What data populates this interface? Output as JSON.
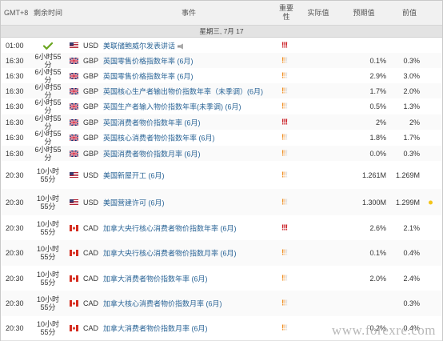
{
  "header": {
    "tz": "GMT+8",
    "remaining": "剩余时间",
    "event": "事件",
    "importance": "重要性",
    "actual": "实际值",
    "forecast": "预期值",
    "previous": "前值"
  },
  "day_label": "星期三, 7月 17",
  "watermark": "www.forexre.com",
  "rows": [
    {
      "time": "01:00",
      "left": "",
      "done": true,
      "flag": "us",
      "cur": "USD",
      "event": "美联储鲍威尔发表讲话",
      "speech": true,
      "imp": 3,
      "actual": "",
      "forecast": "",
      "previous": "",
      "dot": false
    },
    {
      "time": "16:30",
      "left": "6小时55分",
      "done": false,
      "flag": "gb",
      "cur": "GBP",
      "event": "英国零售价格指数年率 (6月)",
      "speech": false,
      "imp": 2,
      "actual": "",
      "forecast": "0.1%",
      "previous": "0.3%",
      "dot": false
    },
    {
      "time": "16:30",
      "left": "6小时55分",
      "done": false,
      "flag": "gb",
      "cur": "GBP",
      "event": "英国零售价格指数年率 (6月)",
      "speech": false,
      "imp": 2,
      "actual": "",
      "forecast": "2.9%",
      "previous": "3.0%",
      "dot": false
    },
    {
      "time": "16:30",
      "left": "6小时55分",
      "done": false,
      "flag": "gb",
      "cur": "GBP",
      "event": "英国核心生产者输出物价指数年率（未季调）(6月)",
      "speech": false,
      "imp": 2,
      "actual": "",
      "forecast": "1.7%",
      "previous": "2.0%",
      "dot": false
    },
    {
      "time": "16:30",
      "left": "6小时55分",
      "done": false,
      "flag": "gb",
      "cur": "GBP",
      "event": "英国生产者输入物价指数年率(未季调) (6月)",
      "speech": false,
      "imp": 2,
      "actual": "",
      "forecast": "0.5%",
      "previous": "1.3%",
      "dot": false
    },
    {
      "time": "16:30",
      "left": "6小时55分",
      "done": false,
      "flag": "gb",
      "cur": "GBP",
      "event": "英国消费者物价指数年率 (6月)",
      "speech": false,
      "imp": 3,
      "actual": "",
      "forecast": "2%",
      "previous": "2%",
      "dot": false
    },
    {
      "time": "16:30",
      "left": "6小时55分",
      "done": false,
      "flag": "gb",
      "cur": "GBP",
      "event": "英国核心消费者物价指数年率 (6月)",
      "speech": false,
      "imp": 2,
      "actual": "",
      "forecast": "1.8%",
      "previous": "1.7%",
      "dot": false
    },
    {
      "time": "16:30",
      "left": "6小时55分",
      "done": false,
      "flag": "gb",
      "cur": "GBP",
      "event": "英国消费者物价指数月率 (6月)",
      "speech": false,
      "imp": 2,
      "actual": "",
      "forecast": "0.0%",
      "previous": "0.3%",
      "dot": false
    },
    {
      "time": "20:30",
      "left": "10小时55分",
      "done": false,
      "flag": "us",
      "cur": "USD",
      "event": "美国新屋开工 (6月)",
      "speech": false,
      "imp": 2,
      "actual": "",
      "forecast": "1.261M",
      "previous": "1.269M",
      "dot": false
    },
    {
      "time": "20:30",
      "left": "10小时55分",
      "done": false,
      "flag": "us",
      "cur": "USD",
      "event": "美国营建许可 (6月)",
      "speech": false,
      "imp": 2,
      "actual": "",
      "forecast": "1.300M",
      "previous": "1.299M",
      "dot": true
    },
    {
      "time": "20:30",
      "left": "10小时55分",
      "done": false,
      "flag": "ca",
      "cur": "CAD",
      "event": "加拿大央行核心消费者物价指数年率 (6月)",
      "speech": false,
      "imp": 3,
      "actual": "",
      "forecast": "2.6%",
      "previous": "2.1%",
      "dot": false
    },
    {
      "time": "20:30",
      "left": "10小时55分",
      "done": false,
      "flag": "ca",
      "cur": "CAD",
      "event": "加拿大央行核心消费者物价指数月率 (6月)",
      "speech": false,
      "imp": 2,
      "actual": "",
      "forecast": "0.1%",
      "previous": "0.4%",
      "dot": false
    },
    {
      "time": "20:30",
      "left": "10小时55分",
      "done": false,
      "flag": "ca",
      "cur": "CAD",
      "event": "加拿大消费者物价指数年率 (6月)",
      "speech": false,
      "imp": 2,
      "actual": "",
      "forecast": "2.0%",
      "previous": "2.4%",
      "dot": false
    },
    {
      "time": "20:30",
      "left": "10小时55分",
      "done": false,
      "flag": "ca",
      "cur": "CAD",
      "event": "加拿大核心消费者物价指数月率 (6月)",
      "speech": false,
      "imp": 2,
      "actual": "",
      "forecast": "",
      "previous": "0.3%",
      "dot": false
    },
    {
      "time": "20:30",
      "left": "10小时55分",
      "done": false,
      "flag": "ca",
      "cur": "CAD",
      "event": "加拿大消费者物价指数月率 (6月)",
      "speech": false,
      "imp": 2,
      "actual": "",
      "forecast": "0.2%",
      "previous": "0.4%",
      "dot": false
    }
  ]
}
